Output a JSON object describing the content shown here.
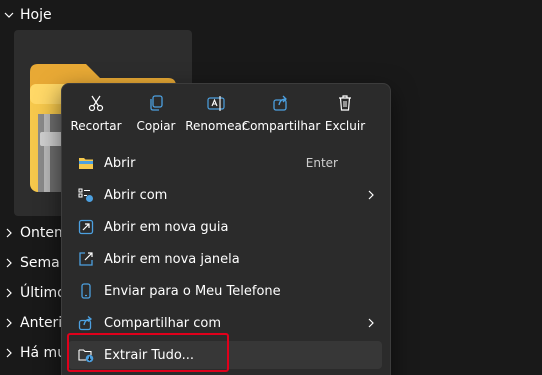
{
  "groups": [
    {
      "label": "Hoje",
      "expanded": true
    },
    {
      "label": "Ontem",
      "expanded": false
    },
    {
      "label": "Semana passada",
      "expanded": false
    },
    {
      "label": "Último mês",
      "expanded": false
    },
    {
      "label": "Anteriormente este ano",
      "expanded": false
    },
    {
      "label": "Há muito tempo",
      "expanded": false
    }
  ],
  "file": {
    "name_fragment": "…",
    "icon": "zip-folder-icon"
  },
  "context_menu": {
    "toolbar": [
      {
        "label": "Recortar",
        "icon": "scissors-icon"
      },
      {
        "label": "Copiar",
        "icon": "copy-icon"
      },
      {
        "label": "Renomear",
        "icon": "rename-icon"
      },
      {
        "label": "Compartilhar",
        "icon": "share-icon"
      },
      {
        "label": "Excluir",
        "icon": "trash-icon"
      }
    ],
    "items": [
      {
        "label": "Abrir",
        "shortcut": "Enter",
        "icon": "folder-open-icon",
        "has_submenu": false
      },
      {
        "label": "Abrir com",
        "shortcut": "",
        "icon": "open-with-icon",
        "has_submenu": true
      },
      {
        "label": "Abrir em nova guia",
        "shortcut": "",
        "icon": "new-tab-icon",
        "has_submenu": false
      },
      {
        "label": "Abrir em nova janela",
        "shortcut": "",
        "icon": "new-window-icon",
        "has_submenu": false
      },
      {
        "label": "Enviar para o Meu Telefone",
        "shortcut": "",
        "icon": "phone-icon",
        "has_submenu": false
      },
      {
        "label": "Compartilhar com",
        "shortcut": "",
        "icon": "share-with-icon",
        "has_submenu": true
      },
      {
        "label": "Extrair Tudo...",
        "shortcut": "",
        "icon": "extract-icon",
        "has_submenu": false,
        "hovered": true
      }
    ]
  },
  "colors": {
    "background": "#191919",
    "menu_bg": "#2b2b2b",
    "hover_bg": "#373737",
    "accent_blue": "#4ca0e0",
    "folder_yellow": "#f5c84c",
    "highlight_red": "#e0001b"
  }
}
